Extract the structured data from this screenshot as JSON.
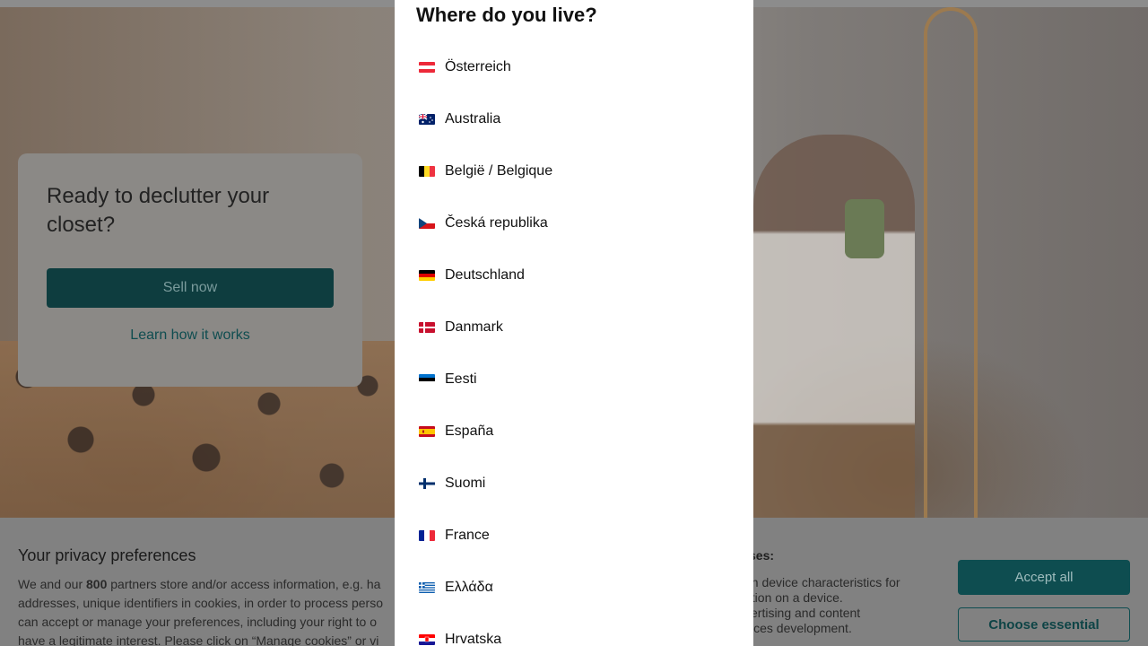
{
  "modal": {
    "title": "Where do you live?",
    "countries": [
      {
        "name": "Österreich",
        "flag": "austria-flag-icon"
      },
      {
        "name": "Australia",
        "flag": "australia-flag-icon"
      },
      {
        "name": "België / Belgique",
        "flag": "belgium-flag-icon"
      },
      {
        "name": "Česká republika",
        "flag": "czech-flag-icon"
      },
      {
        "name": "Deutschland",
        "flag": "germany-flag-icon"
      },
      {
        "name": "Danmark",
        "flag": "denmark-flag-icon"
      },
      {
        "name": "Eesti",
        "flag": "estonia-flag-icon"
      },
      {
        "name": "España",
        "flag": "spain-flag-icon"
      },
      {
        "name": "Suomi",
        "flag": "finland-flag-icon"
      },
      {
        "name": "France",
        "flag": "france-flag-icon"
      },
      {
        "name": "Ελλάδα",
        "flag": "greece-flag-icon"
      },
      {
        "name": "Hrvatska",
        "flag": "croatia-flag-icon"
      }
    ]
  },
  "promo": {
    "title": "Ready to declutter your closet?",
    "sell_button": "Sell now",
    "learn_link": "Learn how it works"
  },
  "privacy": {
    "title": "Your privacy preferences",
    "text_before_count": "We and our ",
    "partner_count": "800",
    "text_after_count": " partners store and/or access information, e.g. ha\naddresses, unique identifiers in cookies, in order to process perso\ncan accept or manage your preferences, including your right to o\nhave a legitimate interest. Please click on “Manage cookies” or vi",
    "purposes_heading": "ses:",
    "purposes_text": "an device characteristics for\nation on a device.\nvertising and content\nvices development.",
    "accept_all": "Accept all",
    "choose_essential": "Choose essential"
  },
  "colors": {
    "brand": "#0e4d50",
    "modal_bg": "#ffffff"
  }
}
